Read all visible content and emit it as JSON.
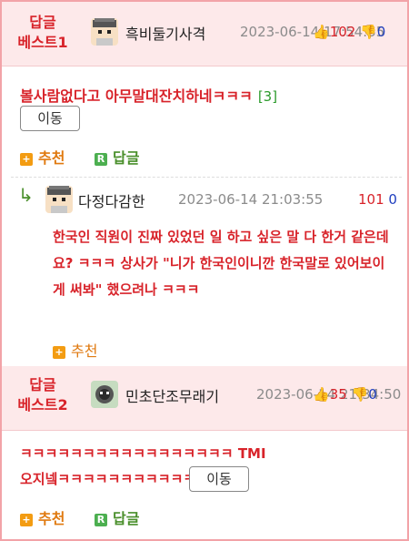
{
  "best1": {
    "tag_line1": "답글",
    "tag_line2": "베스트1",
    "nickname": "흑비둘기사격",
    "timestamp": "2023-06-14 17:54:55",
    "upvotes": "102",
    "downvotes": "0",
    "title": "볼사람없다고 아무말대잔치하네ㅋㅋㅋ",
    "reply_count": "[3]",
    "move_label": "이동",
    "recommend_label": "추천",
    "reply_label": "답글"
  },
  "reply": {
    "arrow": "↳",
    "nickname": "다정다감한",
    "timestamp": "2023-06-14 21:03:55",
    "upvotes": "101",
    "downvotes": "0",
    "body": "한국인 직원이 진짜 있었던 일 하고 싶은 말 다 한거 같은데요? ㅋㅋㅋ 상사가 \"니가 한국인이니깐 한국말로 있어보이게 써봐\" 했으려나 ㅋㅋㅋ",
    "recommend_label": "추천"
  },
  "best2": {
    "tag_line1": "답글",
    "tag_line2": "베스트2",
    "nickname": "민초단조무래기",
    "timestamp": "2023-06-14 21:34:50",
    "upvotes": "35",
    "downvotes": "0",
    "title": "ㅋㅋㅋㅋㅋㅋㅋㅋㅋㅋㅋㅋㅋㅋㅋㅋㅋ TMI오지넼ㅋㅋㅋㅋㅋㅋㅋㅋㅋㅋㅋ",
    "move_label": "이동",
    "recommend_label": "추천",
    "reply_label": "답글"
  },
  "icons": {
    "thumb_up": "👍",
    "thumb_down": "👎",
    "plus": "+",
    "reply_badge": "R"
  },
  "colors": {
    "accent_red": "#d8232a",
    "best_bg": "#fde9ea",
    "border": "#f2a3a8",
    "recommend_orange": "#e07a10",
    "reply_green": "#4a8f2b",
    "down_blue": "#1f3fbf"
  }
}
